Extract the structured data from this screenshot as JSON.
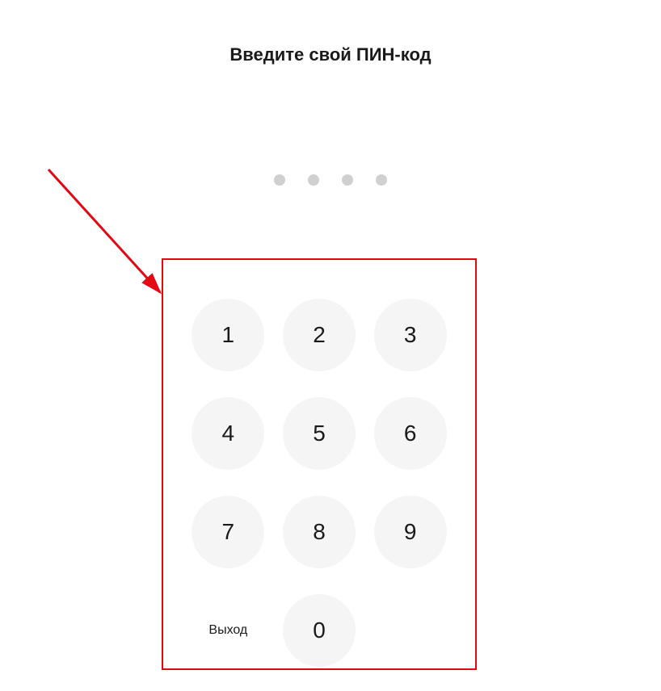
{
  "header": {
    "title": "Введите свой ПИН-код"
  },
  "pin": {
    "length": 4
  },
  "keypad": {
    "keys": {
      "k1": "1",
      "k2": "2",
      "k3": "3",
      "k4": "4",
      "k5": "5",
      "k6": "6",
      "k7": "7",
      "k8": "8",
      "k9": "9",
      "k0": "0"
    },
    "exit_label": "Выход"
  },
  "annotation": {
    "arrow_color": "#e30613"
  }
}
